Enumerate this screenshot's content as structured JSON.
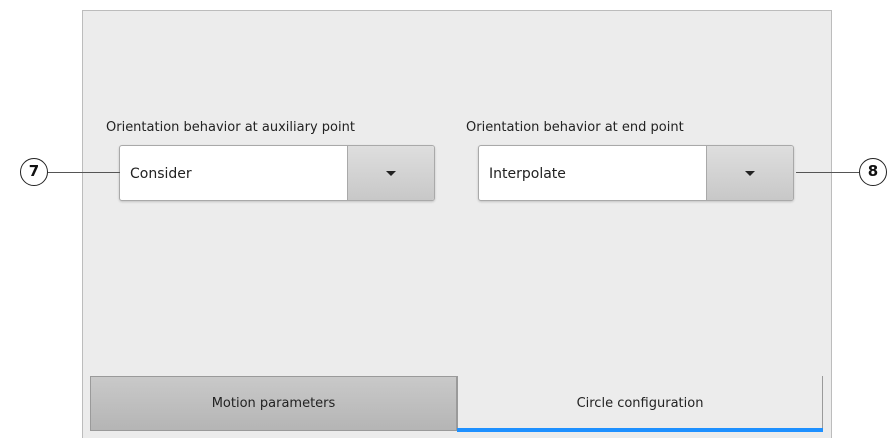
{
  "aux_field": {
    "label": "Orientation behavior at auxiliary point",
    "value": "Consider"
  },
  "end_field": {
    "label": "Orientation behavior at end point",
    "value": "Interpolate"
  },
  "callouts": {
    "left": "7",
    "right": "8"
  },
  "tabs": [
    {
      "label": "Motion parameters",
      "active": false
    },
    {
      "label": "Circle configuration",
      "active": true
    }
  ],
  "colors": {
    "panel_bg": "#ececec",
    "active_tab_indicator": "#1e90ff"
  },
  "icons": {
    "dropdown": "chevron-down-icon"
  }
}
